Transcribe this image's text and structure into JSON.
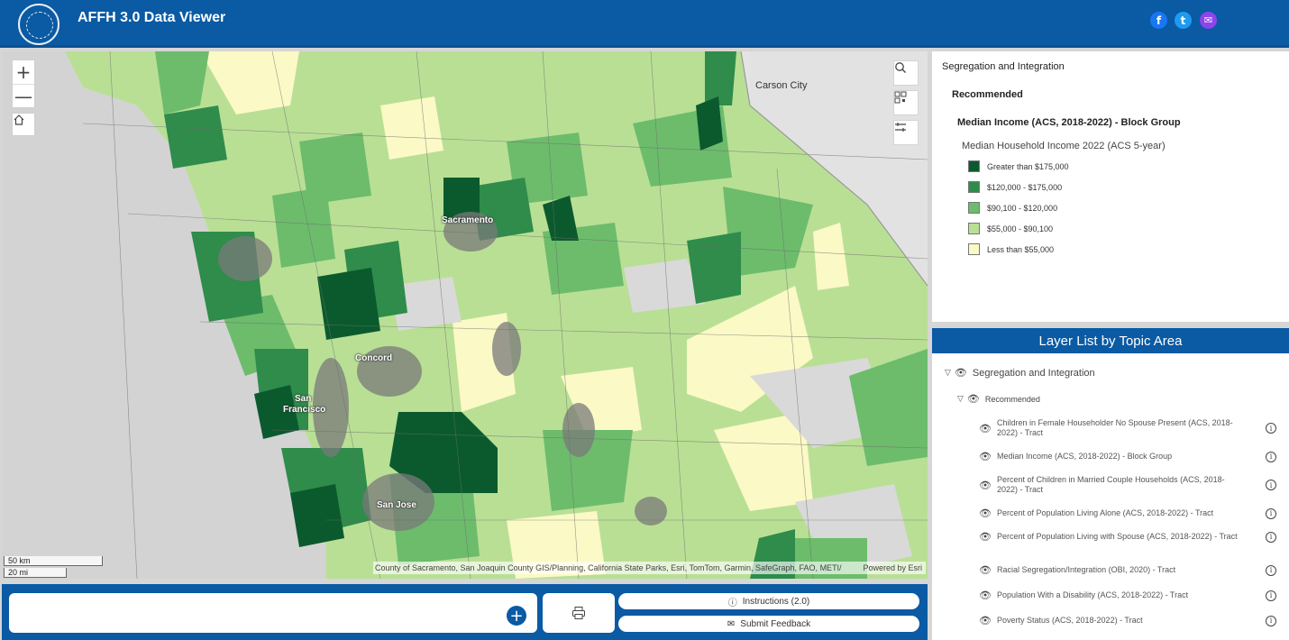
{
  "header": {
    "title": "AFFH 3.0 Data Viewer",
    "logo": "hcd-seal-logo",
    "social": [
      {
        "name": "facebook",
        "glyph": "f"
      },
      {
        "name": "twitter",
        "glyph": "t"
      },
      {
        "name": "email",
        "glyph": "✉"
      }
    ]
  },
  "map": {
    "zoom_in": "+",
    "zoom_out": "—",
    "home_icon": "home-icon",
    "tools": [
      "search-icon",
      "qr-code-icon",
      "layers-toggle-icon"
    ],
    "labels": {
      "carson_city": "Carson City",
      "sacramento": "Sacramento",
      "concord": "Concord",
      "san": "San",
      "francisco": "Francisco",
      "san_jose": "San Jose"
    },
    "scale": {
      "km": "50 km",
      "mi": "20 mi"
    },
    "attribution": "County of Sacramento, San Joaquin County GIS/Planning, California State Parks, Esri, TomTom, Garmin, SafeGraph, FAO, METI/",
    "powered_by": "Powered by Esri"
  },
  "bottom": {
    "add_glyph": "+",
    "print_icon": "print-icon",
    "instructions": "Instructions (2.0)",
    "feedback": "Submit Feedback"
  },
  "legend": {
    "heading": "Segregation and Integration",
    "group": "Recommended",
    "layer": "Median Income (ACS, 2018-2022) - Block Group",
    "field": "Median Household Income 2022 (ACS 5-year)",
    "classes": [
      {
        "label": "Greater than $175,000",
        "color": "#0b5a2e"
      },
      {
        "label": "$120,000 - $175,000",
        "color": "#2f8c4b"
      },
      {
        "label": "$90,100 - $120,000",
        "color": "#6cbc6c"
      },
      {
        "label": "$55,000 - $90,100",
        "color": "#b9df95"
      },
      {
        "label": "Less than $55,000",
        "color": "#fbf9c6"
      }
    ]
  },
  "layer_list": {
    "title": "Layer List by Topic Area",
    "topic": "Segregation and Integration",
    "group": "Recommended",
    "items": [
      "Children in Female Householder No Spouse Present (ACS, 2018-2022) - Tract",
      "Median Income (ACS, 2018-2022) - Block Group",
      "Percent of Children in Married Couple Households (ACS, 2018-2022) - Tract",
      "Percent of Population Living Alone (ACS, 2018-2022) - Tract",
      "Percent of Population Living with Spouse (ACS, 2018-2022) - Tract",
      "Racial Segregation/Integration (OBI, 2020) - Tract",
      "Population With a Disability (ACS, 2018-2022) - Tract",
      "Poverty Status (ACS, 2018-2022) - Tract"
    ]
  }
}
